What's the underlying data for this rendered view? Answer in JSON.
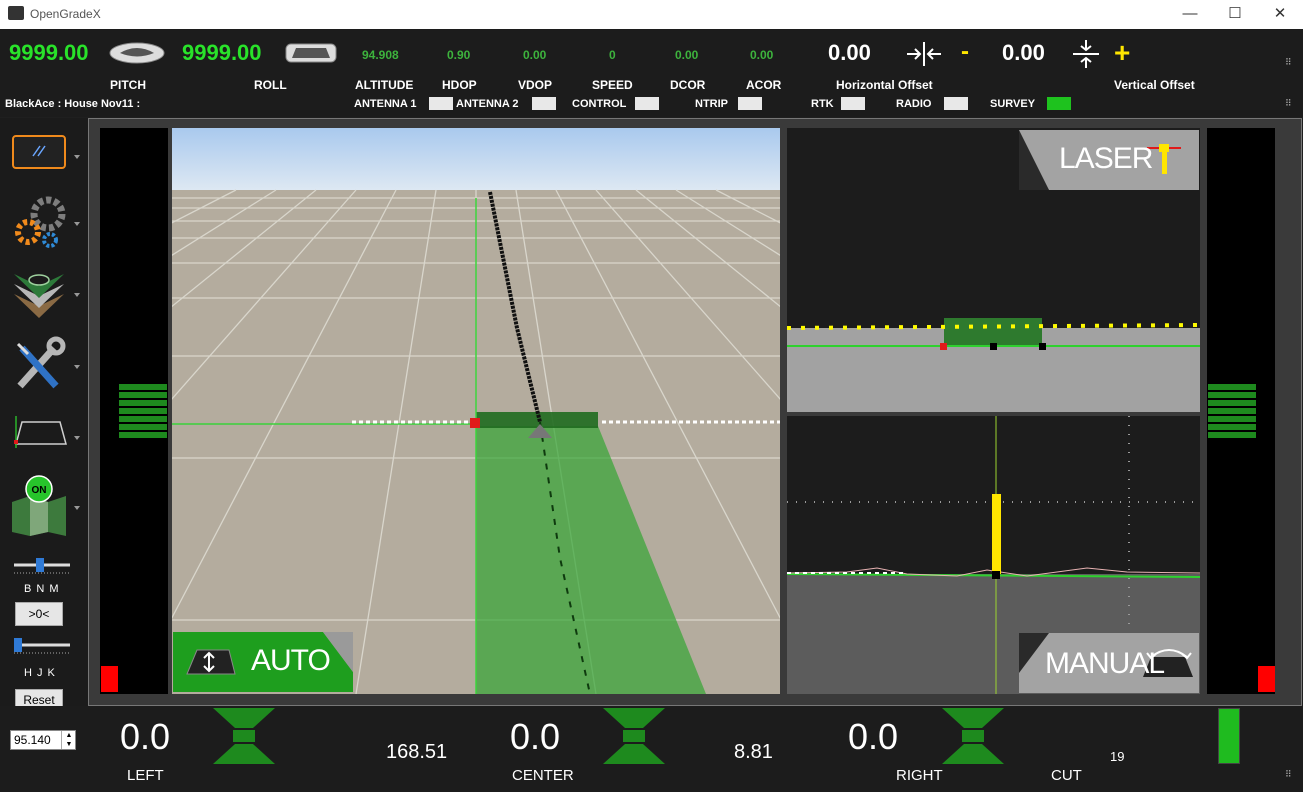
{
  "window": {
    "title": "OpenGradeX",
    "minimize": "—",
    "maximize": "☐",
    "close": "✕"
  },
  "top": {
    "pitch_value": "9999.00",
    "roll_value": "9999.00",
    "altitude": "94.908",
    "hdop": "0.90",
    "vdop": "0.00",
    "speed": "0",
    "dcor": "0.00",
    "acor": "0.00",
    "horizontal_offset": "0.00",
    "vertical_offset": "0.00",
    "horizontal_sign": "-",
    "vertical_sign": "+",
    "labels": {
      "pitch": "PITCH",
      "roll": "ROLL",
      "altitude": "ALTITUDE",
      "hdop": "HDOP",
      "vdop": "VDOP",
      "speed": "SPEED",
      "dcor": "DCOR",
      "acor": "ACOR",
      "horizontal_offset": "Horizontal Offset",
      "vertical_offset": "Vertical Offset"
    }
  },
  "status": {
    "job": "BlackAce : House Nov11 :",
    "antenna1": "ANTENNA 1",
    "antenna2": "ANTENNA 2",
    "control": "CONTROL",
    "ntrip": "NTRIP",
    "rtk": "RTK",
    "radio": "RADIO",
    "survey": "SURVEY"
  },
  "left": {
    "slider1_keys": "B N M",
    "zero_button": ">0<",
    "slider2_keys": "H J K",
    "reset_button": "Reset",
    "spin_value": "95.140"
  },
  "main": {
    "auto_label": "AUTO",
    "laser_label": "LASER",
    "manual_label": "MANUAL"
  },
  "bottom": {
    "left_value": "0.0",
    "mid1": "168.51",
    "center_value": "0.0",
    "mid2": "8.81",
    "right_value": "0.0",
    "cut_value": "19",
    "left_label": "LEFT",
    "center_label": "CENTER",
    "right_label": "RIGHT",
    "cut_label": "CUT"
  },
  "colors": {
    "accent_green": "#29e32a",
    "led_green": "#1e8a1e",
    "alert_red": "#ff0000",
    "yellow": "#ffe600"
  }
}
